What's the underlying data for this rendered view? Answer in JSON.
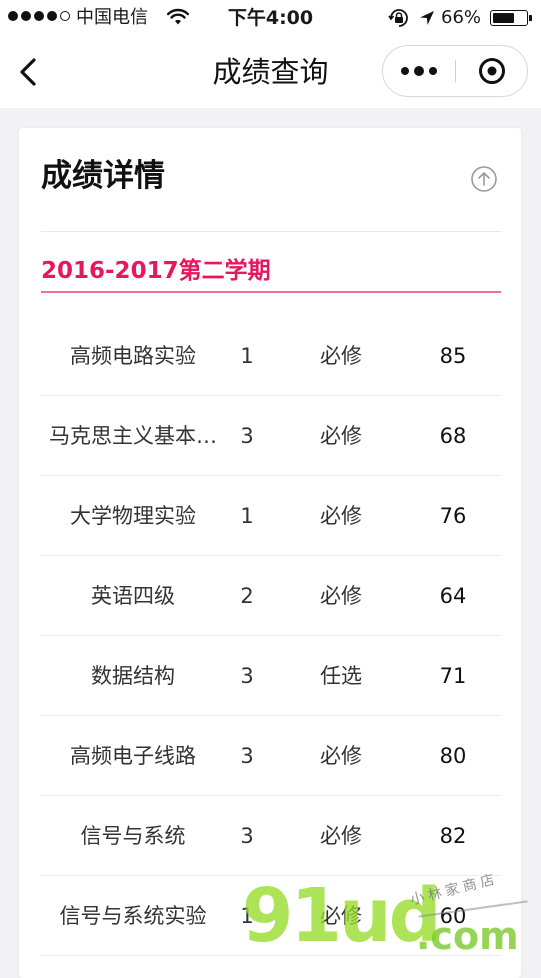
{
  "status_bar": {
    "carrier": "中国电信",
    "time": "下午4:00",
    "battery_percent": "66%",
    "battery_level": 0.66,
    "signal_bars_filled": 4,
    "signal_bars_total": 5,
    "icons": [
      "signal-dots-icon",
      "wifi-icon",
      "rotation-lock-icon",
      "location-arrow-icon",
      "battery-icon"
    ]
  },
  "nav": {
    "title": "成绩查询",
    "back_icon": "chevron-left-icon",
    "more_icon": "more-dots-icon",
    "close_icon": "target-close-icon"
  },
  "card": {
    "heading": "成绩详情",
    "collapse_icon": "arrow-up-circle-icon",
    "term": "2016-2017第二学期",
    "term_color": "#e6175c",
    "courses": [
      {
        "name": "高频电路实验",
        "credit": "1",
        "type": "必修",
        "score": "85"
      },
      {
        "name": "马克思主义基本…",
        "credit": "3",
        "type": "必修",
        "score": "68"
      },
      {
        "name": "大学物理实验",
        "credit": "1",
        "type": "必修",
        "score": "76"
      },
      {
        "name": "英语四级",
        "credit": "2",
        "type": "必修",
        "score": "64"
      },
      {
        "name": "数据结构",
        "credit": "3",
        "type": "任选",
        "score": "71"
      },
      {
        "name": "高频电子线路",
        "credit": "3",
        "type": "必修",
        "score": "80"
      },
      {
        "name": "信号与系统",
        "credit": "3",
        "type": "必修",
        "score": "82"
      },
      {
        "name": "信号与系统实验",
        "credit": "1",
        "type": "必修",
        "score": "60"
      }
    ]
  },
  "watermark": {
    "brand": "91ud",
    "domain": ".com",
    "tagline": "小林家商店"
  }
}
